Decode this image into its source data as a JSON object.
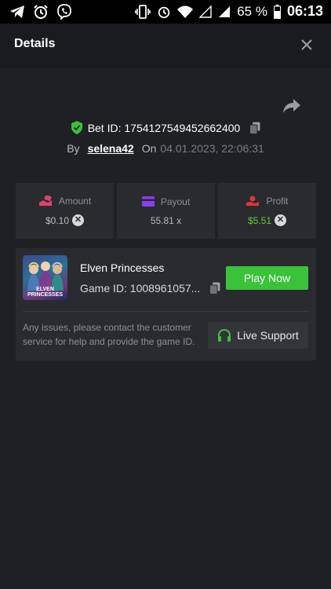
{
  "status_bar": {
    "battery_percent": "65 %",
    "time": "06:13",
    "left_icons": [
      "telegram-icon",
      "alarm-icon",
      "viber-icon"
    ],
    "right_icons": [
      "vibrate-icon",
      "alarm-icon",
      "wifi-icon",
      "signal-empty-icon",
      "signal-icon",
      "battery-icon"
    ]
  },
  "header": {
    "title": "Details",
    "close_icon": "close-icon"
  },
  "bet": {
    "id_text": "Bet ID: 1754127549452662400",
    "by_label": "By",
    "username": "selena42",
    "on_label": "On",
    "date": "04.01.2023, 22:06:31"
  },
  "stats": [
    {
      "label": "Amount",
      "value": "$0.10",
      "icon": "amount-icon",
      "icon_color": "#e0416b"
    },
    {
      "label": "Payout",
      "value": "55.81 x",
      "icon": "payout-card-icon",
      "icon_color": "#8a3ff0"
    },
    {
      "label": "Profit",
      "value": "$5.51",
      "icon": "profit-icon",
      "icon_color": "#e0363b",
      "value_color": "#5dd12c"
    }
  ],
  "game": {
    "name": "Elven Princesses",
    "id_text": "Game ID: 1008961057...",
    "thumb_text": "ELVEN PRINCESSES",
    "play_label": "Play Now",
    "support_text": "Any issues, please contact the customer service for help and provide the game ID.",
    "support_label": "Live Support"
  },
  "colors": {
    "accent_green": "#3ac23a",
    "background": "#1f2023",
    "card": "#2a2b2f"
  }
}
